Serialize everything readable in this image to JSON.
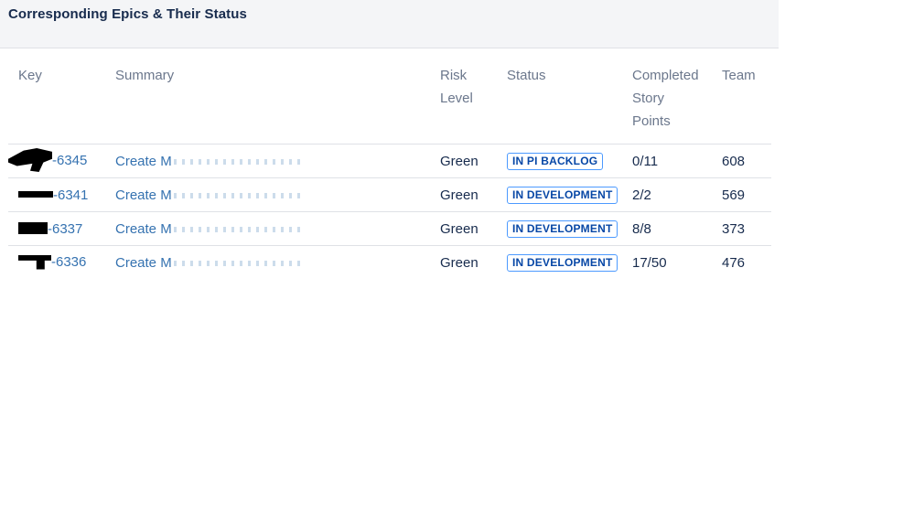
{
  "panel": {
    "title": "Corresponding Epics & Their Status"
  },
  "table": {
    "headers": {
      "key": "Key",
      "summary": "Summary",
      "risk_line1": "Risk",
      "risk_line2": "Level",
      "status": "Status",
      "points_line1": "Completed",
      "points_line2": "Story",
      "points_line3": "Points",
      "team": "Team"
    },
    "rows": [
      {
        "key": "-6345",
        "summary": "Create M",
        "risk": "Green",
        "status": "IN PI BACKLOG",
        "points": "0/11",
        "team": "608"
      },
      {
        "key": "-6341",
        "summary": "Create M",
        "risk": "Green",
        "status": "IN DEVELOPMENT",
        "points": "2/2",
        "team": "569"
      },
      {
        "key": "-6337",
        "summary": "Create M",
        "risk": "Green",
        "status": "IN DEVELOPMENT",
        "points": "8/8",
        "team": "373"
      },
      {
        "key": "-6336",
        "summary": "Create M",
        "risk": "Green",
        "status": "IN DEVELOPMENT",
        "points": "17/50",
        "team": "476"
      }
    ]
  },
  "colors": {
    "header_bg": "#f4f5f7",
    "link": "#3572b0",
    "lozenge_border": "#4c9aff",
    "lozenge_text": "#0747a6"
  }
}
